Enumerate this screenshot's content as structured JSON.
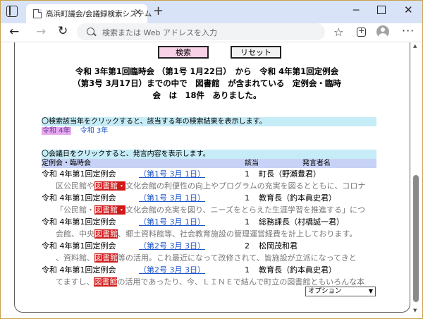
{
  "browser": {
    "tab_title": "高浜町議会/会議録検索システム",
    "tab_close": "×",
    "new_tab": "+",
    "minimize": "─",
    "close": "✕",
    "back": "←",
    "forward": "→",
    "refresh": "↻",
    "address_placeholder": "検索または Web アドレスを入力",
    "favorite": "☆",
    "more": "···"
  },
  "page": {
    "search_button": "検索",
    "reset_button": "リセット",
    "summary": [
      "令和 3年第1回臨時会 （第1号 1月22日）　から　令和 4年第1回定例会",
      "（第3号 3月17日）までの中で　図書館　が含まれている　定例会・臨時",
      "会　は　18件　ありました。"
    ],
    "year_info": "〇検索該当年をクリックすると、該当する年の検索結果を表示します。",
    "years": [
      {
        "label": "令和 4年",
        "selected": true
      },
      {
        "label": "令和 3年",
        "selected": false
      }
    ],
    "meeting_info": "〇会議日をクリックすると、発言内容を表示します。",
    "columns": {
      "meeting": "定例会・臨時会",
      "item": "該当",
      "speaker": "発言者名"
    },
    "rows": [
      {
        "meeting": "令和 4年第1回定例会",
        "date": "（第1号 3月 1日）",
        "count": "1",
        "speaker": "町長（野瀬豊君）",
        "excerpt_before": "区公民館や",
        "excerpt_hl": "図書館・",
        "excerpt_after": "文化会館の利便性の向上やプログラムの充実を図るとともに、コロナ"
      },
      {
        "meeting": "令和 4年第1回定例会",
        "date": "（第1号 3月 1日）",
        "count": "1",
        "speaker": "教育長（釣本眞史君）",
        "excerpt_before": "「公民館・",
        "excerpt_hl": "図書館・",
        "excerpt_after": "文化会館の充実を図り、ニーズをとらえた生涯学習を推進する」につ"
      },
      {
        "meeting": "令和 4年第1回定例会",
        "date": "（第1号 3月 1日）",
        "count": "1",
        "speaker": "総務課長（村橋誠一君）",
        "excerpt_before": "会館、中央",
        "excerpt_hl": "図書館",
        "excerpt_after": "、郷土資料館等、社会教育施設の管理運営経費を計上しております。"
      },
      {
        "meeting": "令和 4年第1回定例会",
        "date": "（第2号 3月 3日）",
        "count": "2",
        "speaker": "松岡茂和君",
        "excerpt_before": "、資料館、",
        "excerpt_hl": "図書館",
        "excerpt_after": "等の活用。これ最近になって改修されて、皆施設が立派になってきと"
      },
      {
        "meeting": "令和 4年第1回定例会",
        "date": "（第2号 3月 3日）",
        "count": "1",
        "speaker": "教育長（釣本眞史君）",
        "excerpt_before": "てますし、",
        "excerpt_hl": "図書館",
        "excerpt_after": "の活用であったり、今、ＬＩＮＥで結んで町立の図書館ともいろんな本"
      }
    ],
    "options_select": "オプション",
    "options_arrow": "▼"
  },
  "colors": {
    "highlight": "#d01818",
    "link": "#1d56c9",
    "info_bar": "#c6ecf7",
    "header_bar": "#c8d2f6",
    "selected_year": "#e6a8ee"
  }
}
